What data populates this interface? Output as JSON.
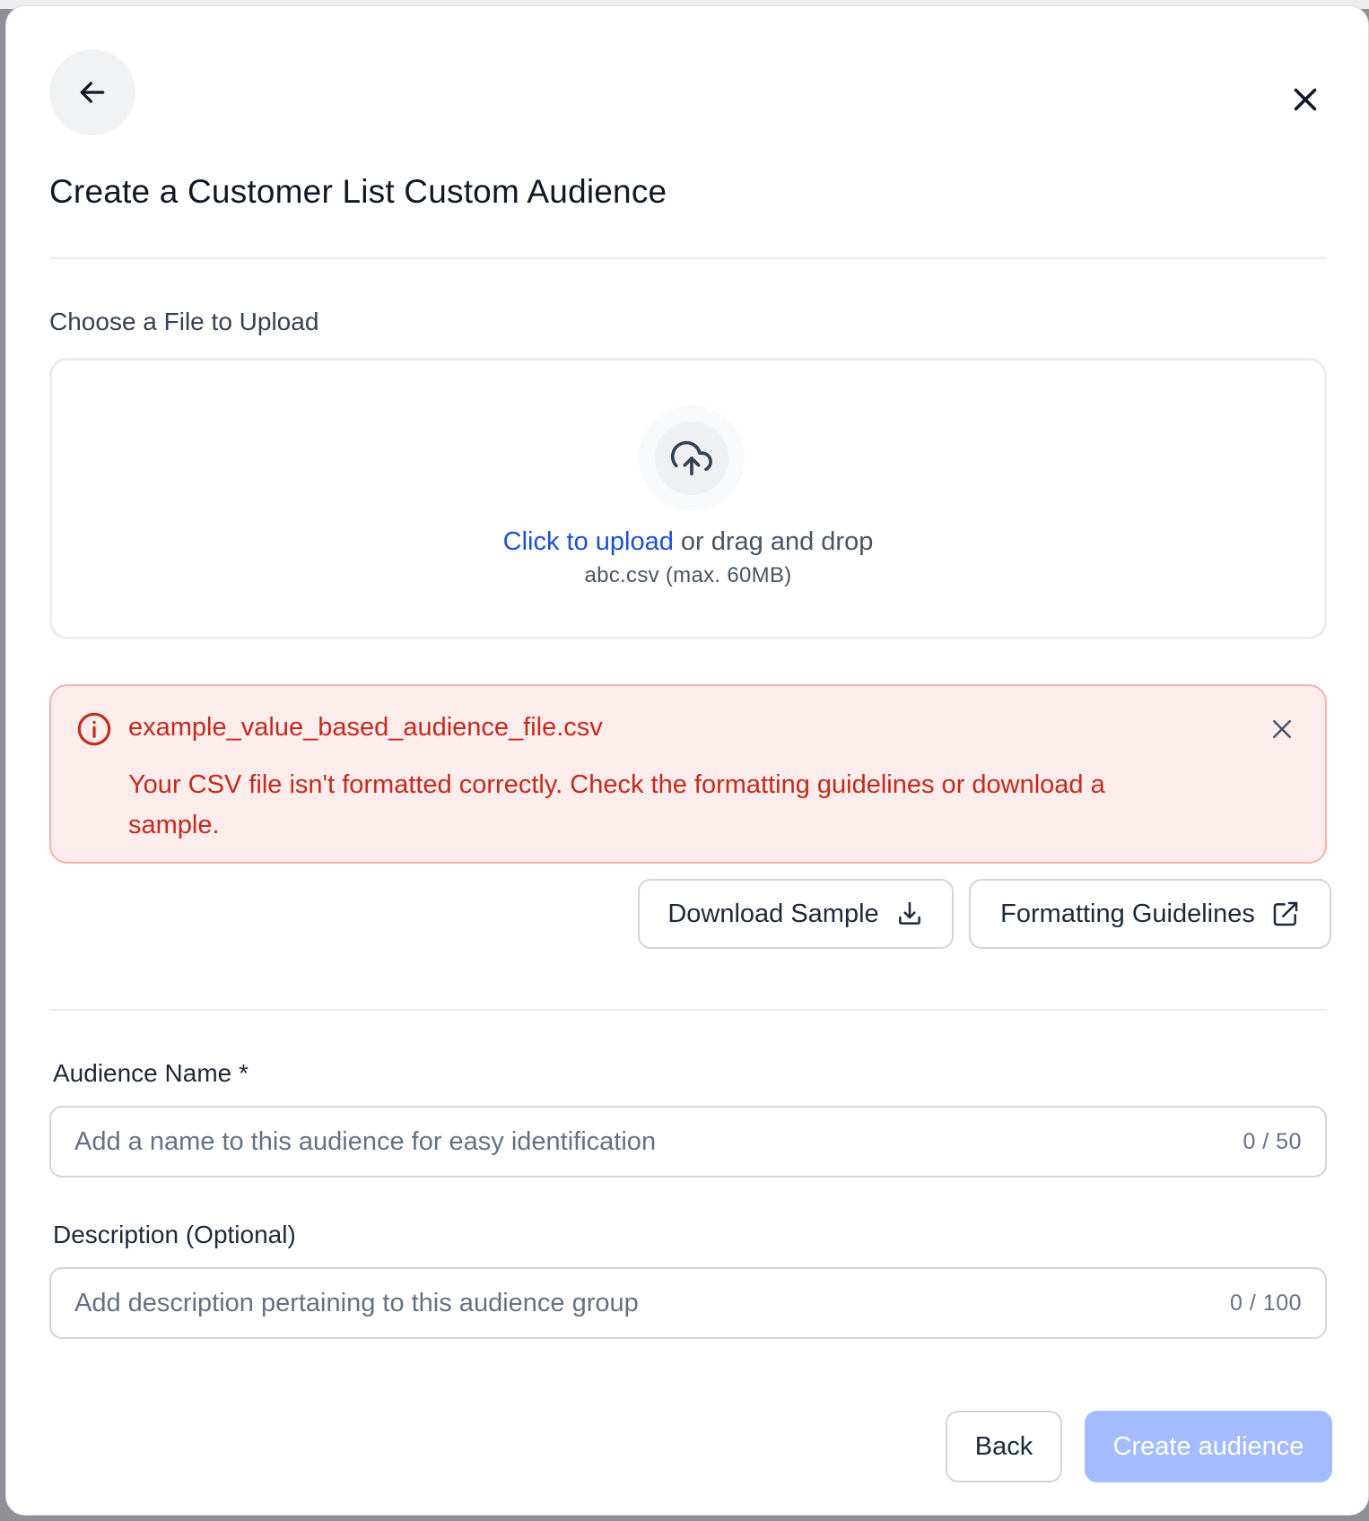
{
  "modal": {
    "title": "Create a Customer List Custom Audience",
    "back_icon": "arrow-left-icon",
    "close_icon": "close-icon"
  },
  "upload": {
    "section_label": "Choose a File to Upload",
    "icon": "upload-cloud-icon",
    "link_text": "Click to upload",
    "rest_text": " or drag and drop",
    "hint": "abc.csv (max. 60MB)"
  },
  "alert": {
    "icon": "alert-circle-icon",
    "filename": "example_value_based_audience_file.csv",
    "message": "Your CSV file isn't formatted correctly. Check the formatting guidelines or download a sample.",
    "close_icon": "close-icon",
    "color": "#c42b1c",
    "background": "#fdecec"
  },
  "actions": {
    "download_sample": "Download Sample",
    "download_icon": "download-icon",
    "formatting_guidelines": "Formatting Guidelines",
    "external_link_icon": "external-link-icon"
  },
  "form": {
    "name_label": "Audience Name *",
    "name_placeholder": "Add a name to this audience for easy identification",
    "name_value": "",
    "name_counter": "0 / 50",
    "description_label": "Description (Optional)",
    "description_placeholder": "Add description pertaining to this audience group",
    "description_value": "",
    "description_counter": "0 / 100"
  },
  "footer": {
    "back_label": "Back",
    "create_label": "Create audience",
    "create_color": "#a4bcfd"
  }
}
